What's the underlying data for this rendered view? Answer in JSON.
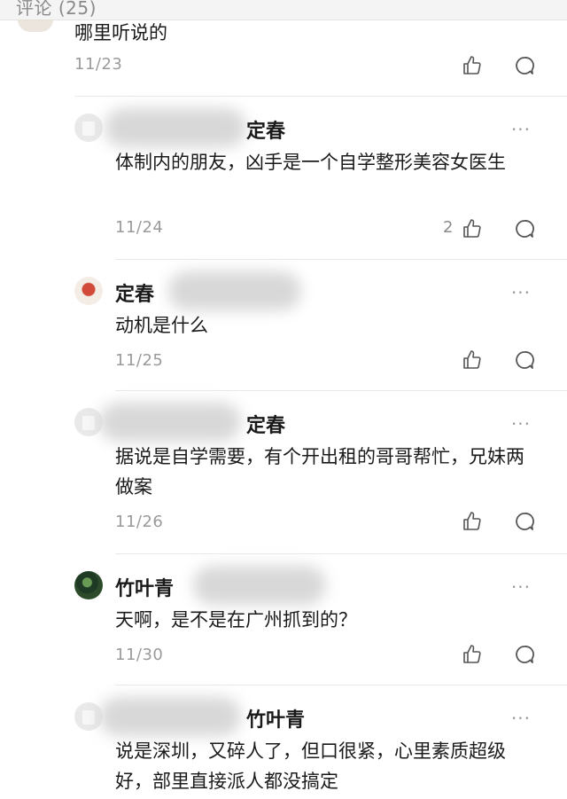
{
  "header": {
    "title": "评论 (25)"
  },
  "comments": [
    {
      "text": "哪里听说的",
      "date": "11/23"
    },
    {
      "name": "定春",
      "text": "体制内的朋友，凶手是一个自学整形美容女医生",
      "date": "11/24",
      "likes": "2"
    },
    {
      "name": "定春",
      "text": "动机是什么",
      "date": "11/25"
    },
    {
      "name": "定春",
      "text": "据说是自学需要，有个开出租的哥哥帮忙，兄妹两做案",
      "date": "11/26"
    },
    {
      "name": "竹叶青",
      "text": "天啊，是不是在广州抓到的？",
      "date": "11/30"
    },
    {
      "name": "竹叶青",
      "text": "说是深圳，又碎人了，但口很紧，心里素质超级好，部里直接派人都没搞定"
    }
  ],
  "more_label": "···",
  "icons": {
    "like": "thumbs-up-icon",
    "reply": "speech-bubble-icon",
    "more": "more-dots-icon"
  }
}
